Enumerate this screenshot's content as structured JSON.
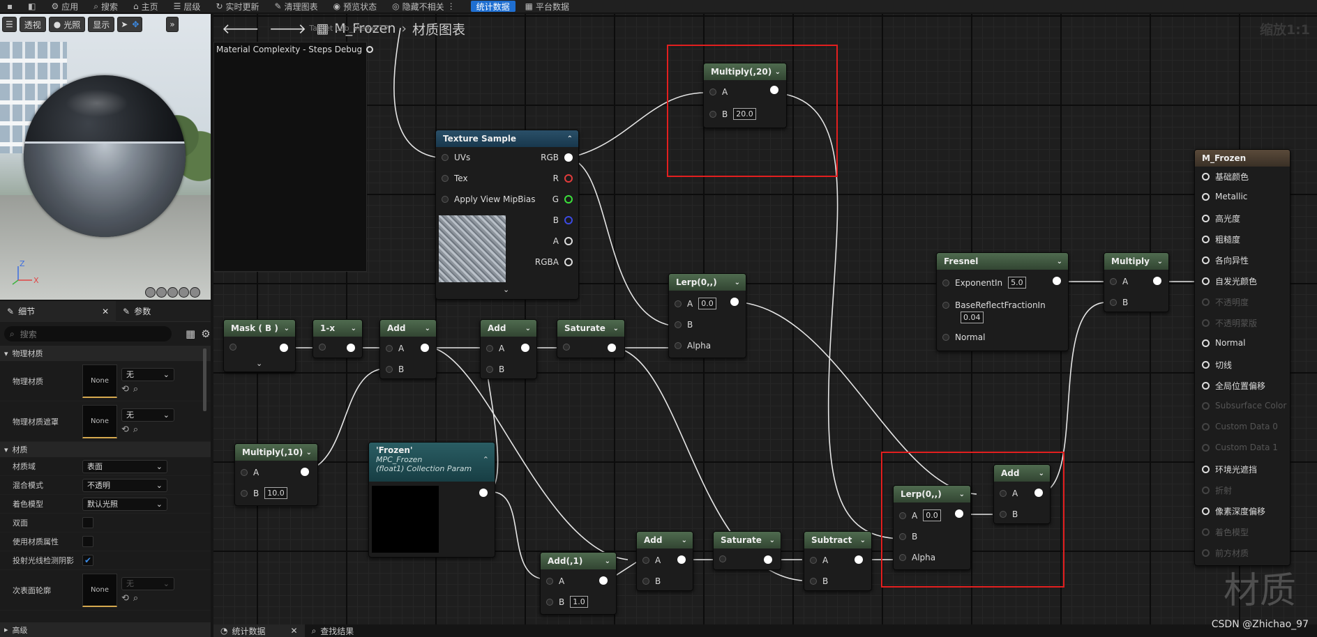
{
  "toolbar": {
    "items": [
      "应用",
      "搜索",
      "主页",
      "层级",
      "实时更新",
      "清理图表",
      "预览状态",
      "隐藏不相关"
    ],
    "stats_btn": "统计数据",
    "platform_btn": "平台数据"
  },
  "viewport": {
    "perspective": "透视",
    "lit": "光照",
    "show": "显示",
    "axis_z": "Z",
    "axis_x": "X"
  },
  "details": {
    "tab_details": "细节",
    "tab_params": "参数",
    "search_placeholder": "搜索",
    "cat_phys": "物理材质",
    "phys_mat": "物理材质",
    "phys_mat_mask": "物理材质遮罩",
    "none": "None",
    "none_cn": "无",
    "cat_material": "材质",
    "domain_label": "材质域",
    "domain_value": "表面",
    "blend_label": "混合模式",
    "blend_value": "不透明",
    "shading_label": "着色模型",
    "shading_value": "默认光照",
    "two_sided": "双面",
    "use_attr": "使用材质属性",
    "ray_shadow": "投射光线检测阴影",
    "subsurface": "次表面轮廓",
    "advanced": "高级"
  },
  "graph": {
    "crumb_icon_label": "M_Frozen",
    "crumb_overlay": "Target Lab_ViewerTP",
    "crumb_page": "材质图表",
    "zoom": "缩放1:1",
    "mcsd": "Material Complexity - Steps Debug"
  },
  "nodes": {
    "multiply20": {
      "title": "Multiply(,20)",
      "a": "A",
      "b": "B",
      "bval": "20.0"
    },
    "texture": {
      "title": "Texture Sample",
      "uvs": "UVs",
      "tex": "Tex",
      "mip": "Apply View MipBias",
      "rgb": "RGB",
      "r": "R",
      "g": "G",
      "b": "B",
      "a": "A",
      "rgba": "RGBA"
    },
    "mask": {
      "title": "Mask ( B )"
    },
    "oneminus": {
      "title": "1-x"
    },
    "add1": {
      "title": "Add",
      "a": "A",
      "b": "B"
    },
    "add2": {
      "title": "Add",
      "a": "A",
      "b": "B"
    },
    "saturate1": {
      "title": "Saturate"
    },
    "lerp1": {
      "title": "Lerp(0,,)",
      "a": "A",
      "aval": "0.0",
      "b": "B",
      "alpha": "Alpha"
    },
    "fresnel": {
      "title": "Fresnel",
      "exp": "ExponentIn",
      "expval": "5.0",
      "base": "BaseReflectFractionIn",
      "baseval": "0.04",
      "normal": "Normal"
    },
    "multiply": {
      "title": "Multiply",
      "a": "A",
      "b": "B"
    },
    "multiply10": {
      "title": "Multiply(,10)",
      "a": "A",
      "b": "B",
      "bval": "10.0"
    },
    "frozen": {
      "title": "'Frozen'",
      "sub1": "MPC_Frozen",
      "sub2": "(float1) Collection Param"
    },
    "add_1": {
      "title": "Add(,1)",
      "a": "A",
      "b": "B",
      "bval": "1.0"
    },
    "add3": {
      "title": "Add",
      "a": "A",
      "b": "B"
    },
    "saturate2": {
      "title": "Saturate"
    },
    "subtract": {
      "title": "Subtract",
      "a": "A",
      "b": "B"
    },
    "lerp2": {
      "title": "Lerp(0,,)",
      "a": "A",
      "aval": "0.0",
      "b": "B",
      "alpha": "Alpha"
    },
    "add4": {
      "title": "Add",
      "a": "A",
      "b": "B"
    },
    "output": {
      "title": "M_Frozen",
      "pins": [
        {
          "label": "基础颜色",
          "enabled": true
        },
        {
          "label": "Metallic",
          "enabled": true
        },
        {
          "label": "高光度",
          "enabled": true
        },
        {
          "label": "粗糙度",
          "enabled": true
        },
        {
          "label": "各向异性",
          "enabled": true
        },
        {
          "label": "自发光颜色",
          "enabled": true
        },
        {
          "label": "不透明度",
          "enabled": false
        },
        {
          "label": "不透明蒙版",
          "enabled": false
        },
        {
          "label": "Normal",
          "enabled": true
        },
        {
          "label": "切线",
          "enabled": true
        },
        {
          "label": "全局位置偏移",
          "enabled": true
        },
        {
          "label": "Subsurface Color",
          "enabled": false
        },
        {
          "label": "Custom Data 0",
          "enabled": false
        },
        {
          "label": "Custom Data 1",
          "enabled": false
        },
        {
          "label": "环境光遮挡",
          "enabled": true
        },
        {
          "label": "折射",
          "enabled": false
        },
        {
          "label": "像素深度偏移",
          "enabled": true
        },
        {
          "label": "着色模型",
          "enabled": false
        },
        {
          "label": "前方材质",
          "enabled": false
        }
      ]
    }
  },
  "bottom": {
    "stats_tab": "统计数据",
    "find_tab": "查找结果"
  },
  "watermark": "材质",
  "csdn": "CSDN @Zhichao_97",
  "colors": {
    "highlight_box": "#e31f1f",
    "accent_blue": "#1f6fd1",
    "node_header": "#4f6b4f"
  }
}
